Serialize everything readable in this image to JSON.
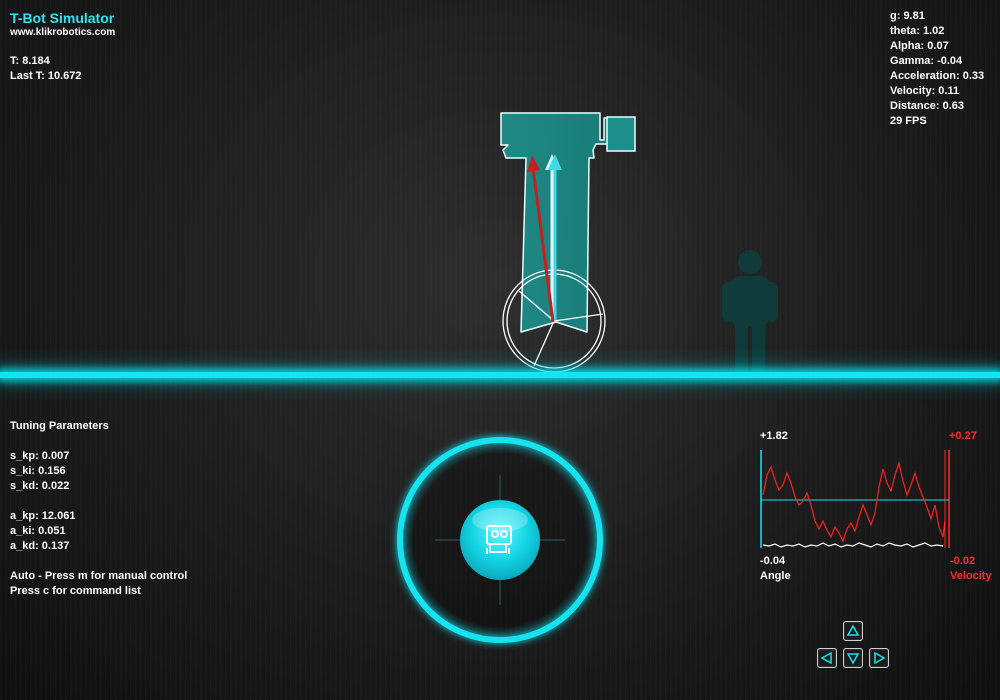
{
  "header": {
    "title": "T-Bot Simulator",
    "url": "www.klikrobotics.com",
    "time": "T: 8.184",
    "last_time": "Last T: 10.672"
  },
  "stats": {
    "g": "g: 9.81",
    "theta": "theta: 1.02",
    "alpha": "Alpha: 0.07",
    "gamma": "Gamma: -0.04",
    "acceleration": "Acceleration: 0.33",
    "velocity": "Velocity: 0.11",
    "distance": "Distance: 0.63",
    "fps": "29 FPS"
  },
  "tuning": {
    "title": "Tuning Parameters",
    "s_kp": "s_kp: 0.007",
    "s_ki": "s_ki: 0.156",
    "s_kd": "s_kd: 0.022",
    "a_kp": "a_kp: 12.061",
    "a_ki": "a_ki: 0.051",
    "a_kd": "a_kd: 0.137",
    "mode": "Auto - Press m for manual control",
    "commands": "Press c for command list"
  },
  "graph": {
    "angle_max": "+1.82",
    "velocity_max": "+0.27",
    "angle_min": "-0.04",
    "velocity_min": "-0.02",
    "angle_label": "Angle",
    "velocity_label": "Velocity"
  },
  "colors": {
    "accent": "#13e6ef",
    "robot_body": "#1e8c88",
    "velocity_trace": "#ff2020",
    "target_arrow": "#cc2222"
  },
  "icons": {
    "joystick_center": "robot-icon",
    "keys": [
      "arrow-up-icon",
      "arrow-left-icon",
      "arrow-down-icon",
      "arrow-right-icon"
    ]
  }
}
